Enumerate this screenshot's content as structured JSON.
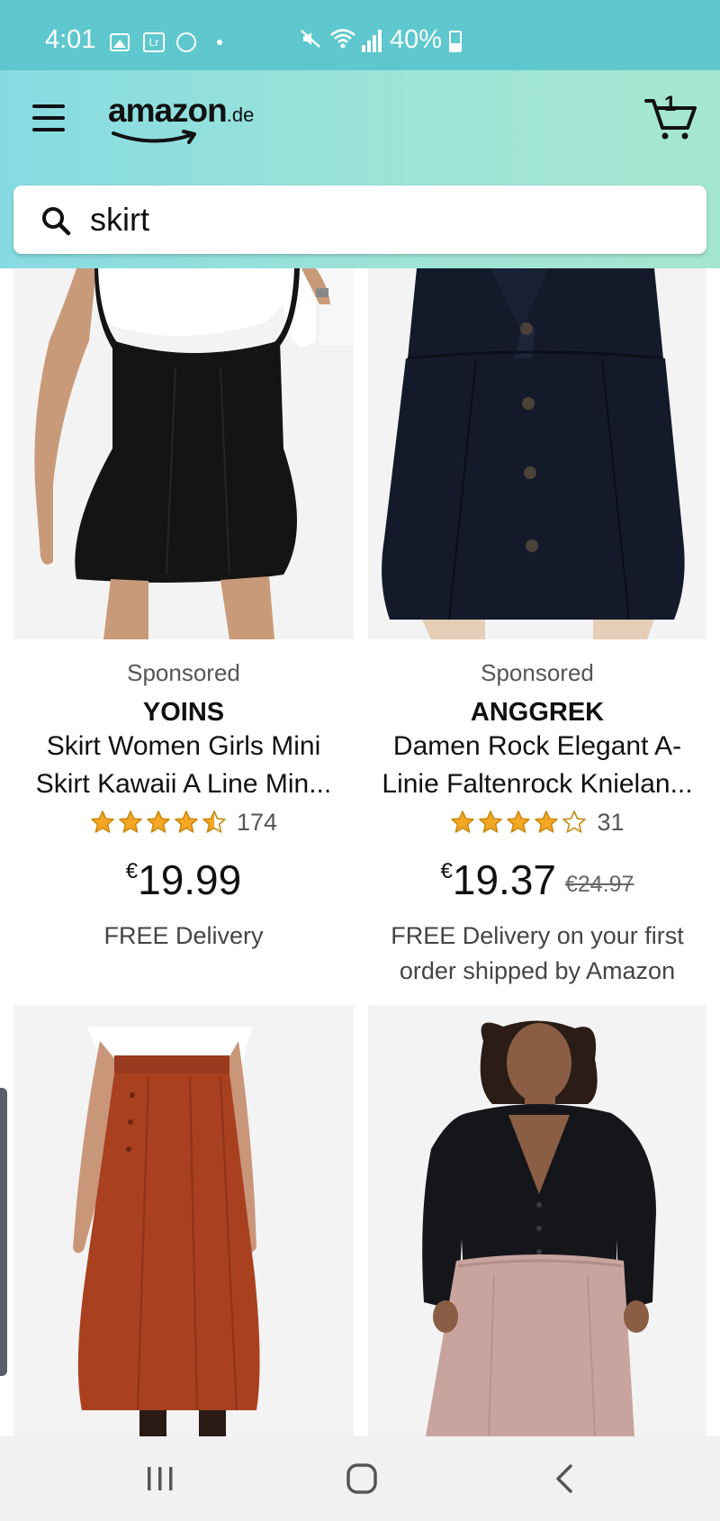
{
  "status_bar": {
    "time": "4:01",
    "lr_label": "Lr",
    "battery": "40%"
  },
  "header": {
    "logo_text": "amazon",
    "logo_tld": ".de",
    "cart_count": "1"
  },
  "search": {
    "value": "skirt"
  },
  "products": [
    {
      "sponsored": "Sponsored",
      "brand": "YOINS",
      "title_line1": "Skirt Women Girls Mini",
      "title_line2": "Skirt Kawaii A Line Min...",
      "rating": 4.5,
      "rating_count": "174",
      "price_currency": "€",
      "price": "19.99",
      "old_price": "",
      "delivery_line1": "FREE Delivery",
      "delivery_line2": ""
    },
    {
      "sponsored": "Sponsored",
      "brand": "ANGGREK",
      "title_line1": "Damen Rock Elegant A-",
      "title_line2": "Linie Faltenrock Knielan...",
      "rating": 4,
      "rating_count": "31",
      "price_currency": "€",
      "price": "19.37",
      "old_price": "€24.97",
      "delivery_line1": "FREE Delivery on your first",
      "delivery_line2": "order shipped by Amazon"
    }
  ],
  "colors": {
    "status_bar": "#5ec8ce",
    "header_start": "#86dbe2",
    "header_end": "#a5e6cf",
    "star": "#f5a623"
  },
  "icons": [
    "menu-icon",
    "cart-icon",
    "search-icon",
    "recents-icon",
    "home-icon",
    "back-icon"
  ]
}
